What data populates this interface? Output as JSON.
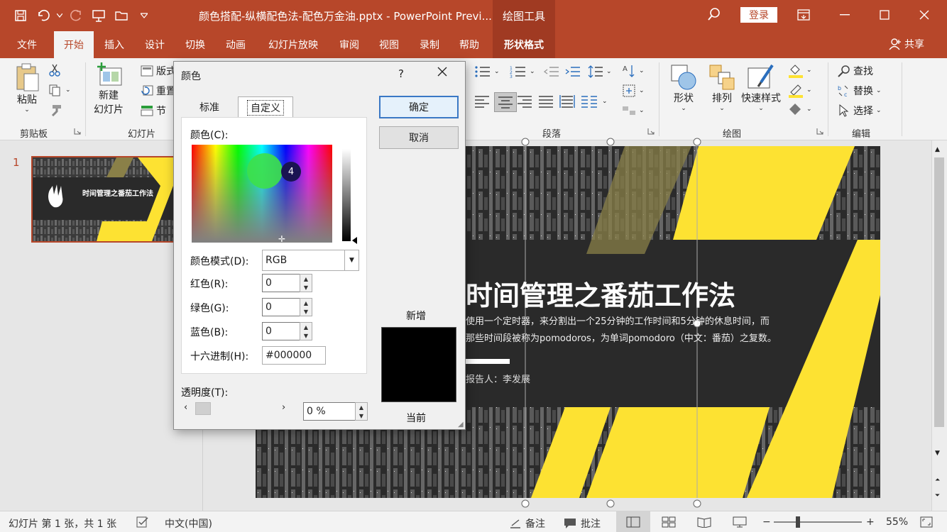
{
  "window": {
    "title": "颜色搭配-纵横配色法-配色万金油.pptx - PowerPoint Previ...",
    "context_tab": "绘图工具",
    "login": "登录"
  },
  "tabs": [
    "文件",
    "开始",
    "插入",
    "设计",
    "切换",
    "动画",
    "幻灯片放映",
    "审阅",
    "视图",
    "录制",
    "帮助",
    "形状格式"
  ],
  "share": "共享",
  "ribbon": {
    "paste": "粘贴",
    "clipboard": "剪贴板",
    "new_slide_1": "新建",
    "new_slide_2": "幻灯片",
    "layout": "版式",
    "reset": "重置",
    "section": "节",
    "slides_group": "幻灯片",
    "paragraph": "段落",
    "shape": "形状",
    "arrange": "排列",
    "quick_styles": "快速样式",
    "drawing": "绘图",
    "find": "查找",
    "replace": "替换",
    "select": "选择",
    "editing": "编辑"
  },
  "slide_pane": {
    "number": "1",
    "thumb_title": "时间管理之番茄工作法"
  },
  "slide": {
    "title": "时间管理之番茄工作法",
    "line1": "使用一个定时器，来分割出一个25分钟的工作时间和5分钟的休息时间，而",
    "line2": "那些时间段被称为pomodoros，为单词pomodoro（中文：番茄）之复数。",
    "reporter": "报告人：李发展"
  },
  "dialog": {
    "title": "颜色",
    "help": "?",
    "tab_standard": "标准",
    "tab_custom": "自定义",
    "colors_label": "颜色(C):",
    "badge": "4",
    "mode_label": "颜色模式(D):",
    "mode_value": "RGB",
    "red_label": "红色(R):",
    "red_value": "0",
    "green_label": "绿色(G):",
    "green_value": "0",
    "blue_label": "蓝色(B):",
    "blue_value": "0",
    "hex_label": "十六进制(H):",
    "hex_value": "#000000",
    "transparency_label": "透明度(T):",
    "transparency_value": "0 %",
    "ok": "确定",
    "cancel": "取消",
    "new_label": "新增",
    "current_label": "当前"
  },
  "status": {
    "slide_info": "幻灯片 第 1 张，共 1 张",
    "language": "中文(中国)",
    "notes": "备注",
    "comments": "批注",
    "zoom": "55%"
  },
  "colors": {
    "accent": "#b7472a",
    "yellow": "#fde232",
    "dark": "#2a2a2a"
  }
}
